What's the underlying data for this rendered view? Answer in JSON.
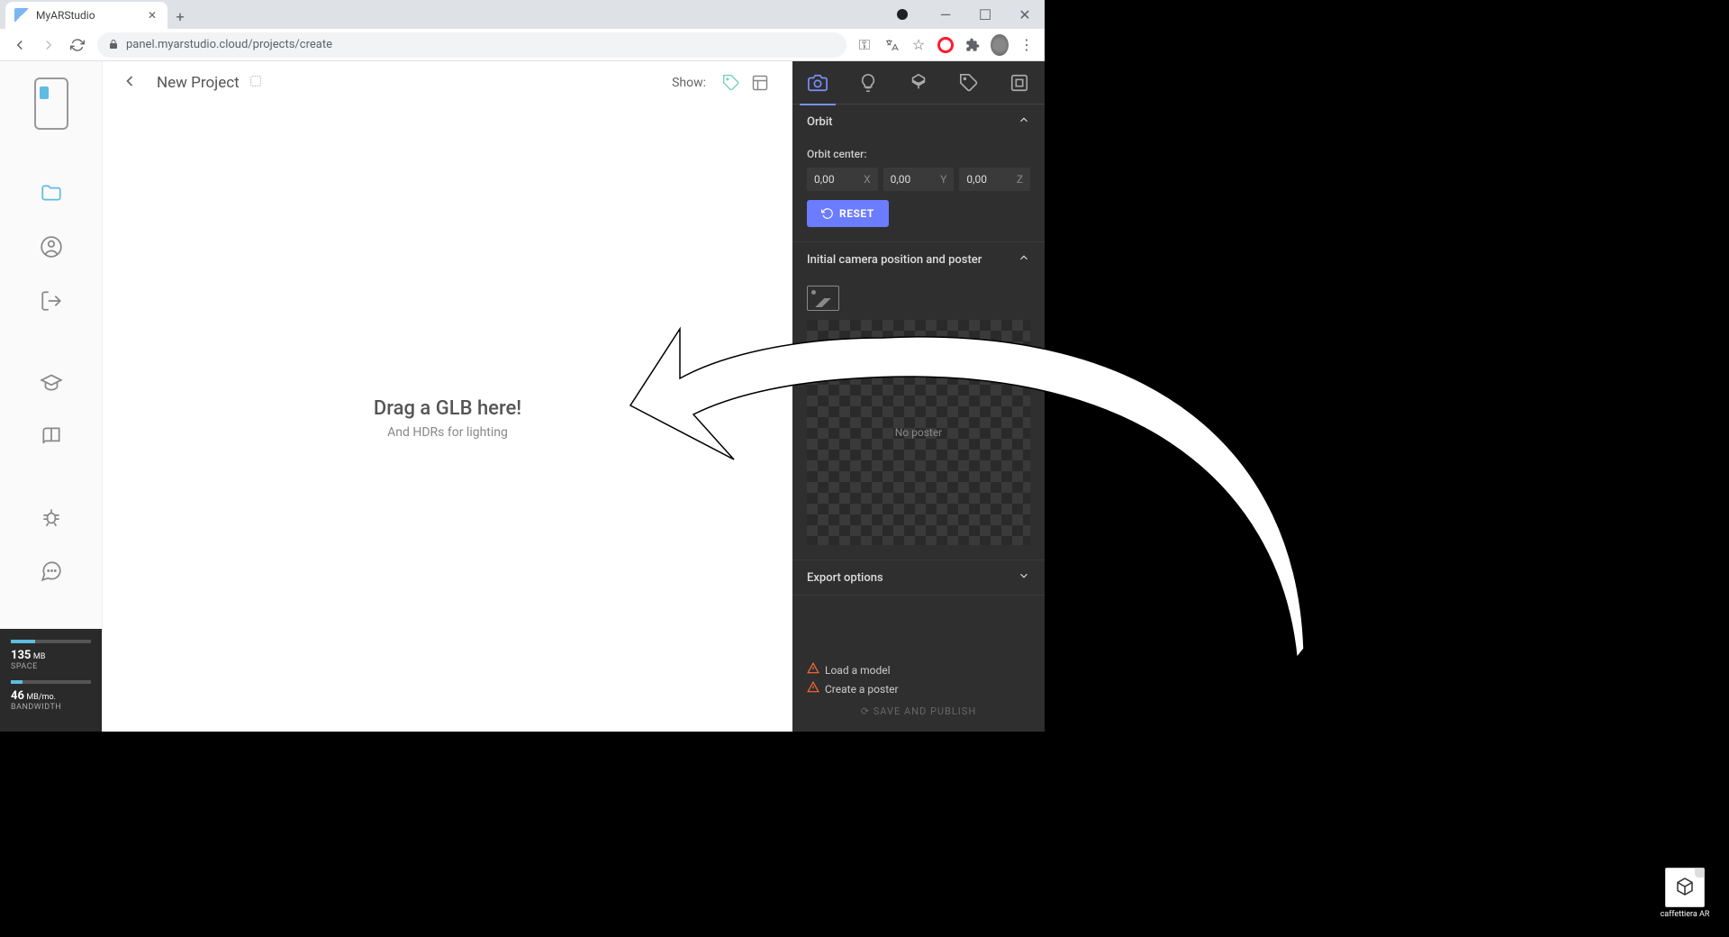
{
  "browser": {
    "tab_title": "MyARStudio",
    "url": "panel.myarstudio.cloud/projects/create"
  },
  "header": {
    "title": "New Project",
    "show_label": "Show:"
  },
  "canvas": {
    "drop_title": "Drag a GLB here!",
    "drop_sub": "And HDRs for lighting"
  },
  "usage": {
    "space_value": "135",
    "space_unit": "MB",
    "space_label": "SPACE",
    "bw_value": "46",
    "bw_unit": "MB/mo.",
    "bw_label": "BANDWIDTH"
  },
  "panel": {
    "orbit_title": "Orbit",
    "orbit_center_label": "Orbit center:",
    "x_val": "0,00",
    "y_val": "0,00",
    "z_val": "0,00",
    "x_lbl": "X",
    "y_lbl": "Y",
    "z_lbl": "Z",
    "reset_label": "RESET",
    "camera_title": "Initial camera position and poster",
    "no_poster": "No poster",
    "export_title": "Export options",
    "warn1": "Load a model",
    "warn2": "Create a poster",
    "publish": "SAVE AND PUBLISH"
  },
  "file": {
    "name": "caffettiera AR"
  }
}
